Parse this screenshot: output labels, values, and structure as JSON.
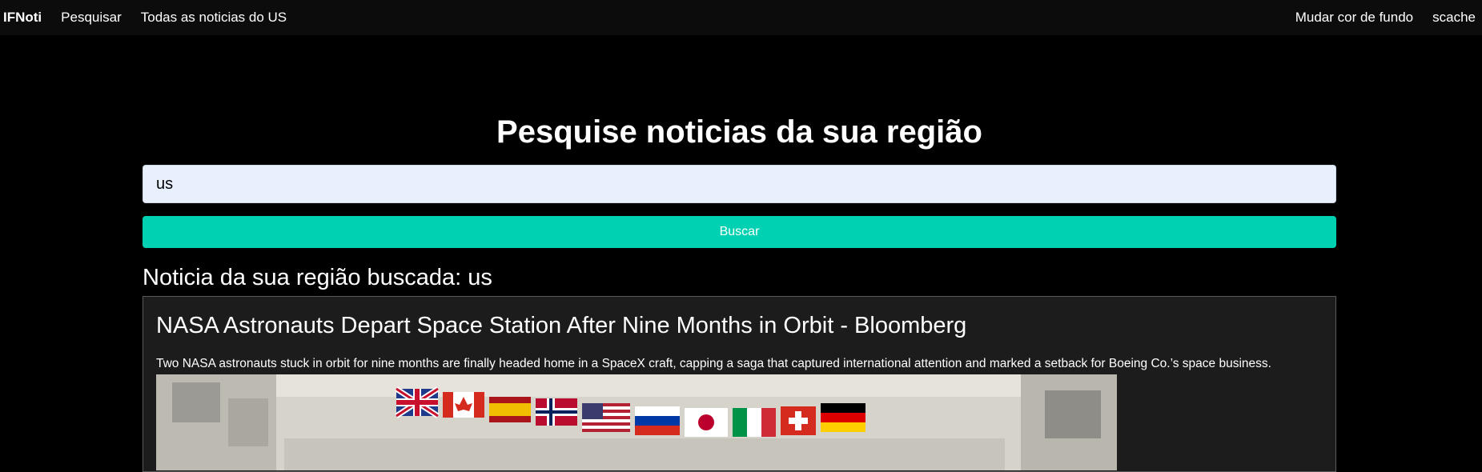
{
  "nav": {
    "brand": "IFNoti",
    "links": [
      "Pesquisar",
      "Todas as noticias do US"
    ],
    "right_links": [
      "Mudar cor de fundo",
      "scache"
    ]
  },
  "search": {
    "title": "Pesquise noticias da sua região",
    "input_value": "us",
    "button_label": "Buscar"
  },
  "results": {
    "heading": "Noticia da sua região buscada: us",
    "articles": [
      {
        "title": "NASA Astronauts Depart Space Station After Nine Months in Orbit - Bloomberg",
        "description": "Two NASA astronauts stuck in orbit for nine months are finally headed home in a SpaceX craft, capping a saga that captured international attention and marked a setback for Boeing Co.’s space business.",
        "image_icon": "photo-flags-space-station"
      }
    ]
  },
  "colors": {
    "background": "#000000",
    "navbar": "#0c0c0c",
    "accent": "#00d1b2",
    "input_bg": "#e8f0fe",
    "card_bg": "#1c1c1c"
  }
}
